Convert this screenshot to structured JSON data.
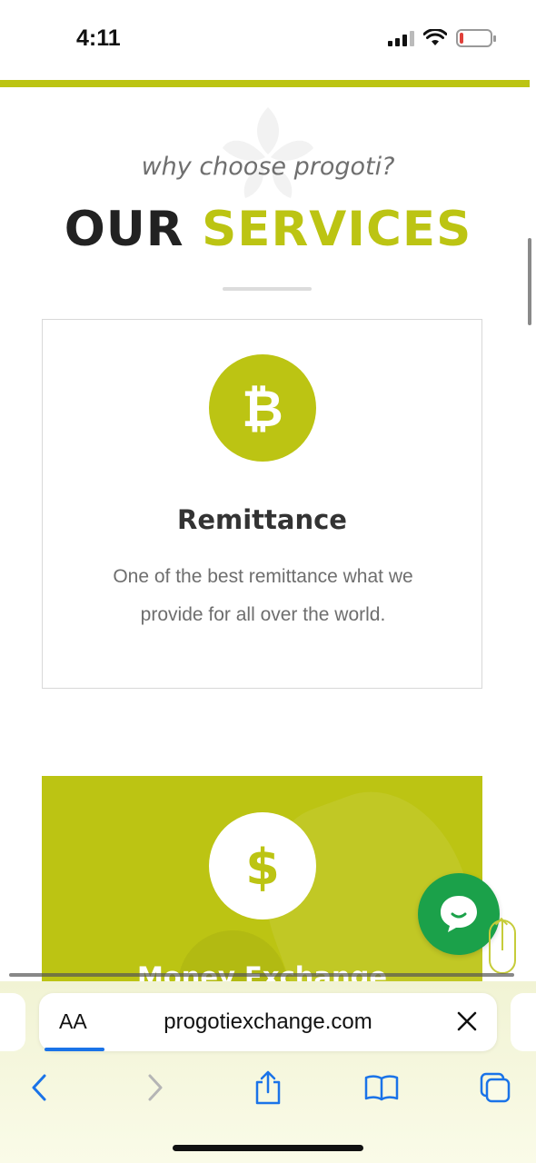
{
  "status": {
    "time": "4:11"
  },
  "section": {
    "subtitle": "why choose progoti?",
    "title_part1": "OUR",
    "title_part2": "SERVICES"
  },
  "cards": [
    {
      "icon": "bitcoin-icon",
      "icon_glyph": "₿",
      "title": "Remittance",
      "description": "One of the best remittance what we provide for all over the world."
    },
    {
      "icon": "dollar-icon",
      "icon_glyph": "$",
      "title": "Money Exchange"
    }
  ],
  "browser": {
    "aa_label": "AA",
    "url": "progotiexchange.com"
  },
  "colors": {
    "accent": "#bcc413",
    "chat": "#1ba14a",
    "link_blue": "#1a73e8"
  }
}
